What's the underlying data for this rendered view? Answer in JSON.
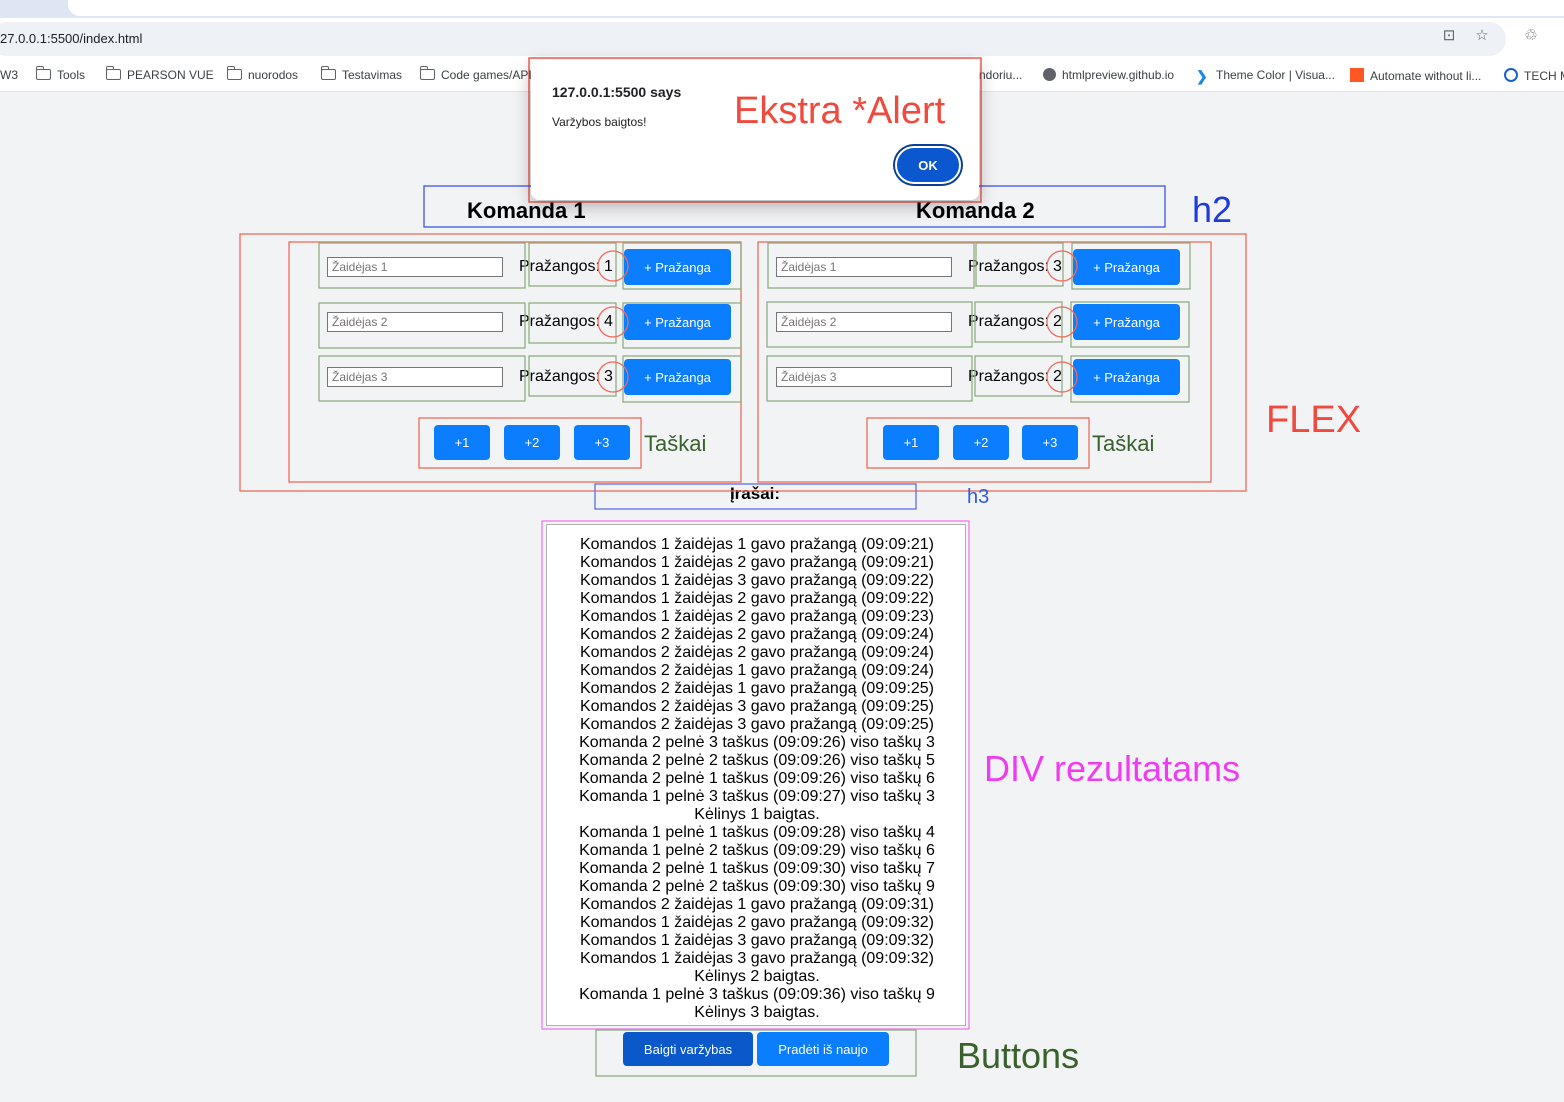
{
  "browser": {
    "url": "27.0.0.1:5500/index.html",
    "bookmarks": [
      {
        "label": "W3",
        "icon": "none"
      },
      {
        "label": "Tools",
        "icon": "folder-icon"
      },
      {
        "label": "PEARSON VUE",
        "icon": "folder-icon"
      },
      {
        "label": "nuorodos",
        "icon": "folder-icon"
      },
      {
        "label": "Testavimas",
        "icon": "folder-icon"
      },
      {
        "label": "Code games/API",
        "icon": "folder-icon"
      },
      {
        "label": "ndoriu...",
        "icon": "none"
      },
      {
        "label": "htmlpreview.github.io",
        "icon": "globe-icon"
      },
      {
        "label": "Theme Color | Visua...",
        "icon": "vscode-icon"
      },
      {
        "label": "Automate without li...",
        "icon": "square-logo-icon"
      },
      {
        "label": "TECH M",
        "icon": "ring-icon"
      }
    ]
  },
  "alert": {
    "origin": "127.0.0.1:5500 says",
    "message": "Varžybos baigtos!",
    "ok_label": "OK"
  },
  "annotations": {
    "alert": "Ekstra *Alert",
    "h2": "h2",
    "flex": "FLEX",
    "h3": "h3",
    "results_div": "DIV rezultatams",
    "buttons": "Buttons"
  },
  "teams": [
    {
      "name": "Komanda 1",
      "players": [
        {
          "placeholder": "Žaidėjas 1",
          "fouls_label": "Pražangos:",
          "fouls": "1",
          "button": "+ Pražanga"
        },
        {
          "placeholder": "Žaidėjas 2",
          "fouls_label": "Pražangos:",
          "fouls": "4",
          "button": "+ Pražanga"
        },
        {
          "placeholder": "Žaidėjas 3",
          "fouls_label": "Pražangos:",
          "fouls": "3",
          "button": "+ Pražanga"
        }
      ],
      "point_buttons": [
        "+1",
        "+2",
        "+3"
      ],
      "points_label": "Taškai"
    },
    {
      "name": "Komanda 2",
      "players": [
        {
          "placeholder": "Žaidėjas 1",
          "fouls_label": "Pražangos:",
          "fouls": "3",
          "button": "+ Pražanga"
        },
        {
          "placeholder": "Žaidėjas 2",
          "fouls_label": "Pražangos:",
          "fouls": "2",
          "button": "+ Pražanga"
        },
        {
          "placeholder": "Žaidėjas 3",
          "fouls_label": "Pražangos:",
          "fouls": "2",
          "button": "+ Pražanga"
        }
      ],
      "point_buttons": [
        "+1",
        "+2",
        "+3"
      ],
      "points_label": "Taškai"
    }
  ],
  "entries_title": "Įrašai:",
  "log": [
    "Komandos 1 žaidėjas 1 gavo pražangą (09:09:21)",
    "Komandos 1 žaidėjas 2 gavo pražangą (09:09:21)",
    "Komandos 1 žaidėjas 3 gavo pražangą (09:09:22)",
    "Komandos 1 žaidėjas 2 gavo pražangą (09:09:22)",
    "Komandos 1 žaidėjas 2 gavo pražangą (09:09:23)",
    "Komandos 2 žaidėjas 2 gavo pražangą (09:09:24)",
    "Komandos 2 žaidėjas 2 gavo pražangą (09:09:24)",
    "Komandos 2 žaidėjas 1 gavo pražangą (09:09:24)",
    "Komandos 2 žaidėjas 1 gavo pražangą (09:09:25)",
    "Komandos 2 žaidėjas 3 gavo pražangą (09:09:25)",
    "Komandos 2 žaidėjas 3 gavo pražangą (09:09:25)",
    "Komanda 2 pelnė 3 taškus (09:09:26) viso taškų 3",
    "Komanda 2 pelnė 2 taškus (09:09:26) viso taškų 5",
    "Komanda 2 pelnė 1 taškus (09:09:26) viso taškų 6",
    "Komanda 1 pelnė 3 taškus (09:09:27) viso taškų 3",
    "Kėlinys 1 baigtas.",
    "Komanda 1 pelnė 1 taškus (09:09:28) viso taškų 4",
    "Komanda 1 pelnė 2 taškus (09:09:29) viso taškų 6",
    "Komanda 2 pelnė 1 taškus (09:09:30) viso taškų 7",
    "Komanda 2 pelnė 2 taškus (09:09:30) viso taškų 9",
    "Komandos 2 žaidėjas 1 gavo pražangą (09:09:31)",
    "Komandos 1 žaidėjas 2 gavo pražangą (09:09:32)",
    "Komandos 1 žaidėjas 3 gavo pražangą (09:09:32)",
    "Komandos 1 žaidėjas 3 gavo pražangą (09:09:32)",
    "Kėlinys 2 baigtas.",
    "Komanda 1 pelnė 3 taškus (09:09:36) viso taškų 9",
    "Kėlinys 3 baigtas."
  ],
  "controls": {
    "finish_label": "Baigti varžybas",
    "restart_label": "Pradėti iš naujo"
  },
  "colors": {
    "primary_button": "#0b7dff",
    "dark_button": "#0a58ca",
    "annotation_red": "#f04a3e",
    "annotation_blue": "#1f3bd8",
    "annotation_magenta": "#f03cf0",
    "annotation_green": "#38612c",
    "annotation_lightblue": "#2e5fd8"
  }
}
